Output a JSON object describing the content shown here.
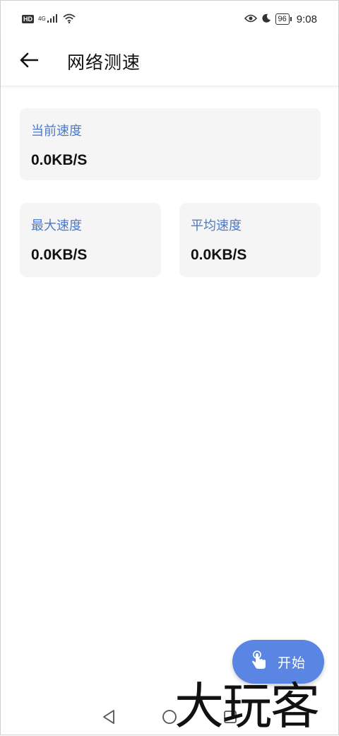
{
  "status_bar": {
    "hd": "HD",
    "network": "4G",
    "battery": "96",
    "time": "9:08"
  },
  "header": {
    "title": "网络测速"
  },
  "cards": {
    "current": {
      "label": "当前速度",
      "value": "0.0KB/S"
    },
    "max": {
      "label": "最大速度",
      "value": "0.0KB/S"
    },
    "average": {
      "label": "平均速度",
      "value": "0.0KB/S"
    }
  },
  "fab": {
    "label": "开始"
  },
  "watermark": "大玩客",
  "colors": {
    "accent": "#5a85e3",
    "label_blue": "#4d79c9",
    "card_bg": "#f5f5f5"
  },
  "icons": {
    "back": "arrow-left-icon",
    "fab": "touch-hand-icon",
    "nav_back": "triangle-back-icon",
    "nav_home": "circle-home-icon",
    "nav_recent": "square-recent-icon"
  }
}
